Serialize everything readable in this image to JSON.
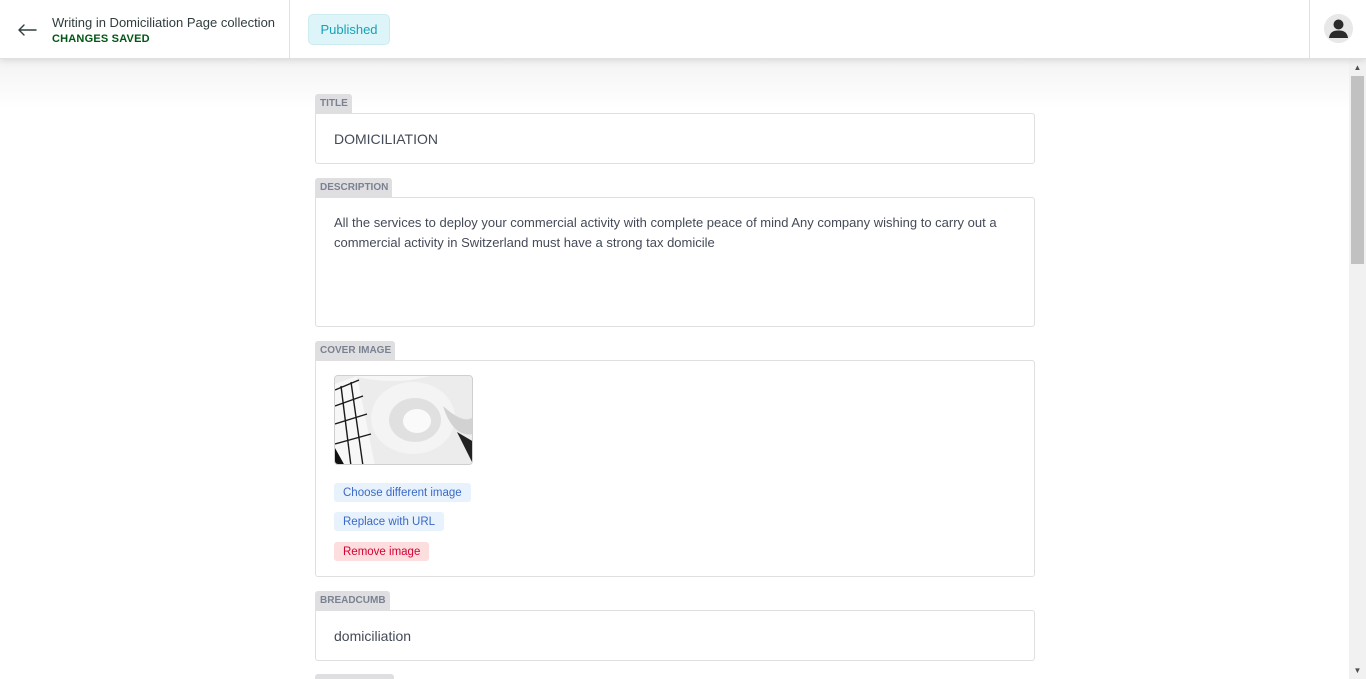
{
  "header": {
    "title": "Writing in Domiciliation Page collection",
    "save_status": "CHANGES SAVED",
    "publish_status": "Published",
    "icons": {
      "back": "arrow-left-icon",
      "account": "user-avatar-icon"
    }
  },
  "fields": {
    "title": {
      "label": "TITLE",
      "value": "DOMICILIATION"
    },
    "description": {
      "label": "DESCRIPTION",
      "value": "All the services to deploy your commercial activity with complete peace of mind Any company wishing to carry out a commercial activity in Switzerland must have a strong tax domicile"
    },
    "cover_image": {
      "label": "COVER IMAGE",
      "choose_label": "Choose different image",
      "replace_label": "Replace with URL",
      "remove_label": "Remove image"
    },
    "breadcumb": {
      "label": "BREADCUMB",
      "value": "domiciliation"
    }
  },
  "colors": {
    "saved_green": "#005614",
    "published_bg": "#ddf5f9",
    "published_text": "#17a2b8",
    "button_blue": "#3a69c7",
    "button_red": "#d60032"
  }
}
